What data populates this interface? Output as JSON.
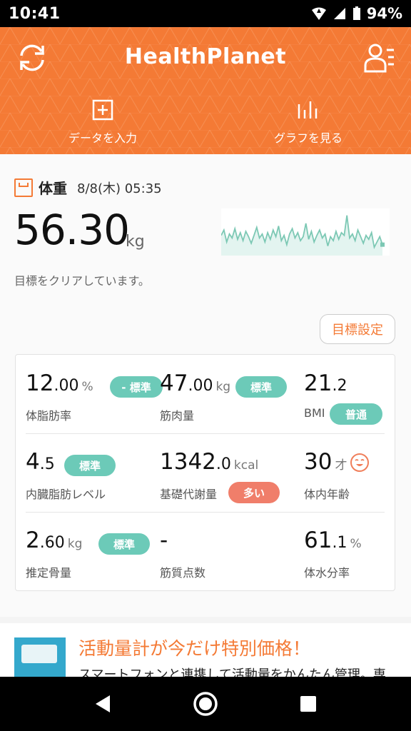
{
  "status": {
    "time": "10:41",
    "battery": "94%"
  },
  "header": {
    "title": "HealthPlanet",
    "actions": [
      {
        "label": "データを入力",
        "icon": "plus-box-icon"
      },
      {
        "label": "グラフを見る",
        "icon": "bar-chart-icon"
      }
    ]
  },
  "weight": {
    "label": "体重",
    "date": "8/8(木) 05:35",
    "value": "56.30",
    "unit": "kg",
    "message": "目標をクリアしています。",
    "trend": [
      56.4,
      56.8,
      55.9,
      56.5,
      56.2,
      56.9,
      56.1,
      56.6,
      56.0,
      56.7,
      56.3,
      55.8,
      56.4,
      57.0,
      56.2,
      56.5,
      55.9,
      56.6,
      56.1,
      56.8,
      56.3,
      57.1,
      56.0,
      56.4,
      55.7,
      56.5,
      56.9,
      56.2,
      56.6,
      56.0,
      56.3,
      57.3,
      56.1,
      56.7,
      55.9,
      56.4,
      56.8,
      56.2,
      56.5,
      55.6,
      56.3,
      56.0,
      56.7,
      56.1,
      56.6,
      56.4,
      57.9,
      56.2,
      56.5,
      56.0,
      56.8,
      56.3,
      55.8,
      56.4,
      56.1,
      56.6,
      55.5,
      55.9,
      56.3,
      55.7
    ]
  },
  "goal_button": "目標設定",
  "metrics": [
    {
      "int": "12",
      "dec": ".00",
      "unit": "%",
      "label": "体脂肪率",
      "badge": "- 標準",
      "badge_color": "#6ccab8"
    },
    {
      "int": "47",
      "dec": ".00",
      "unit": "kg",
      "label": "筋肉量",
      "badge": "標準",
      "badge_color": "#6ccab8"
    },
    {
      "int": "21",
      "dec": ".2",
      "unit": "",
      "label": "BMI",
      "badge": "普通",
      "badge_color": "#6ccab8"
    },
    {
      "int": "4",
      "dec": ".5",
      "unit": "",
      "label": "内臓脂肪レベル",
      "badge": "標準",
      "badge_color": "#6ccab8"
    },
    {
      "int": "1342",
      "dec": ".0",
      "unit": "kcal",
      "label": "基礎代謝量",
      "badge": "多い",
      "badge_color": "#f07e6a"
    },
    {
      "int": "30",
      "dec": "",
      "unit": "才",
      "label": "体内年齢",
      "icon": "smiley-face-icon"
    },
    {
      "int": "2",
      "dec": ".60",
      "unit": "kg",
      "label": "推定骨量",
      "badge": "標準",
      "badge_color": "#6ccab8"
    },
    {
      "int": "-",
      "dec": "",
      "unit": "",
      "label": "筋質点数"
    },
    {
      "int": "61",
      "dec": ".1",
      "unit": "%",
      "label": "体水分率"
    }
  ],
  "promo": {
    "title": "活動量計が今だけ特別価格！",
    "desc": "スマートフォンと連携して活動量をかんたん管理。専"
  },
  "colors": {
    "brand": "#f47a35",
    "teal": "#6ccab8",
    "salmon": "#f07e6a"
  }
}
